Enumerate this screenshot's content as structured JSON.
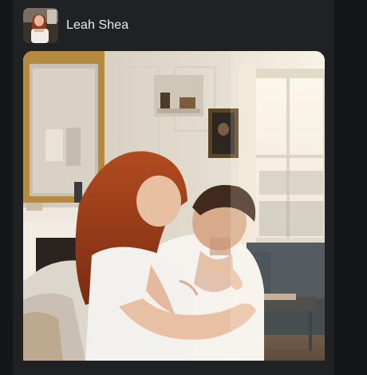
{
  "post": {
    "author_name": "Leah Shea",
    "avatar_icon": "user-avatar-icon",
    "photo_icon": "post-photo"
  },
  "colors": {
    "page_bg": "#141517",
    "card_bg": "#202123",
    "author_text": "#ececec"
  }
}
